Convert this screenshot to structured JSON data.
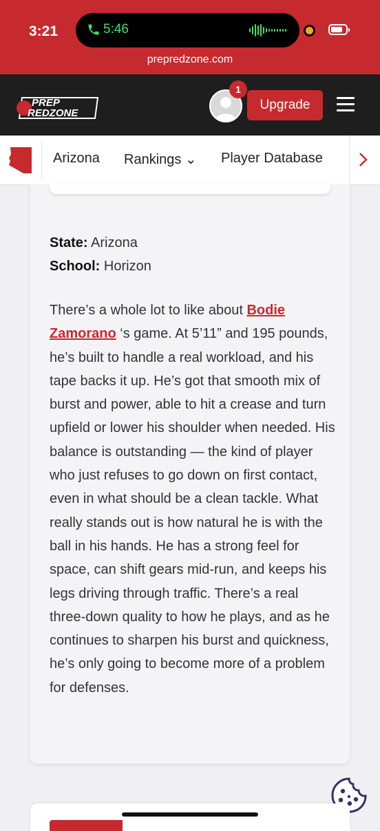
{
  "status_bar": {
    "time": "3:21",
    "call_time": "5:46",
    "url": "prepredzone.com"
  },
  "header": {
    "logo_text_top": "PREP",
    "logo_text_bottom": "REDZONE",
    "notification_count": "1",
    "upgrade_label": "Upgrade"
  },
  "nav": {
    "items": [
      {
        "label": "Arizona"
      },
      {
        "label": "Rankings ⌄"
      },
      {
        "label": "Player Database"
      }
    ]
  },
  "article": {
    "state_label": "State:",
    "state_value": "Arizona",
    "school_label": "School:",
    "school_value": "Horizon",
    "intro": "There’s a whole lot to like about ",
    "player_link": "Bodie Zamorano",
    "body": " ‘s game. At 5’11” and 195 pounds, he’s built to handle a real workload, and his tape backs it up. He’s got that smooth mix of burst and power, able to hit a crease and turn upfield or lower his shoulder when needed. His balance is outstanding — the kind of player who just refuses to go down on first contact, even in what should be a clean tackle. What really stands out is how natural he is with the ball in his hands. He has a strong feel for space, can shift gears mid-run, and keeps his legs driving through traffic. There’s a real three-down quality to how he plays, and as he continues to sharpen his burst and quickness, he’s only going to become more of a problem for defenses."
  },
  "colors": {
    "brand_red": "#c72a2e",
    "header_bg": "#1e1e1e",
    "call_green": "#3fe06a"
  },
  "icons": [
    "phone-icon",
    "audio-wave-icon",
    "battery-icon",
    "avatar-icon",
    "menu-icon",
    "arizona-state-icon",
    "chevron-right-icon",
    "cookie-icon"
  ]
}
